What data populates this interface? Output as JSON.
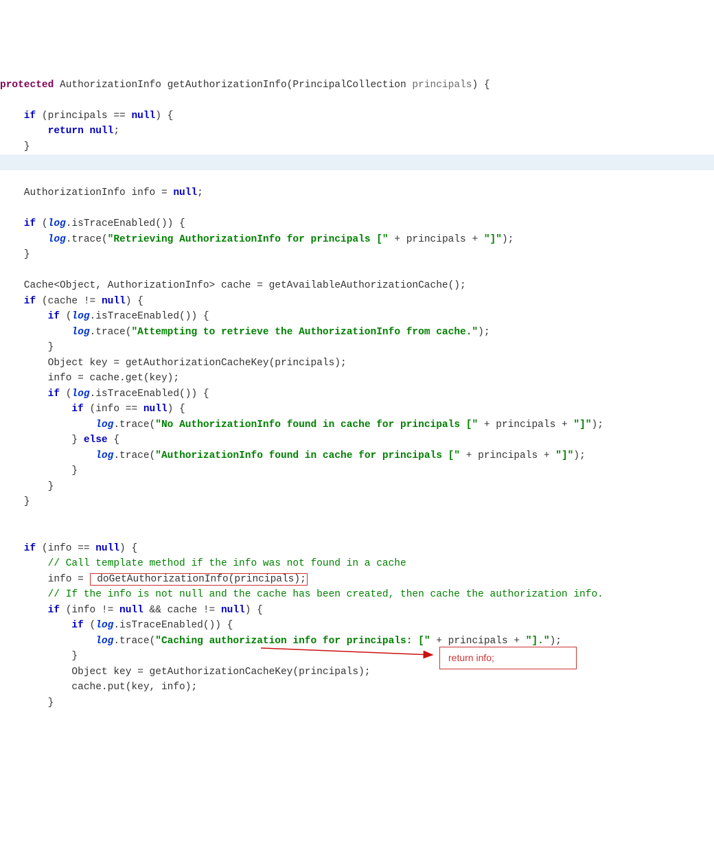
{
  "code": {
    "l00": "protected",
    "l00b": " AuthorizationInfo getAuthorizationInfo(PrincipalCollection ",
    "l00c": "principals",
    "l00d": ") {",
    "l01a": "    if",
    "l01b": " (principals == ",
    "l01c": "null",
    "l01d": ") {",
    "l02a": "        return null",
    "l02b": ";",
    "l03": "    }",
    "l04a": "    AuthorizationInfo info = ",
    "l04b": "null",
    "l04c": ";",
    "l05a": "    if",
    "l05b": " (",
    "l05c": "log",
    "l05d": ".isTraceEnabled()) {",
    "l06a": "        ",
    "l06b": "log",
    "l06c": ".trace(",
    "l06d": "\"Retrieving AuthorizationInfo for principals [\"",
    "l06e": " + principals + ",
    "l06f": "\"]\"",
    "l06g": ");",
    "l07": "    }",
    "l08": "    Cache<Object, AuthorizationInfo> cache = getAvailableAuthorizationCache();",
    "l09a": "    if",
    "l09b": " (cache != ",
    "l09c": "null",
    "l09d": ") {",
    "l10a": "        if",
    "l10b": " (",
    "l10c": "log",
    "l10d": ".isTraceEnabled()) {",
    "l11a": "            ",
    "l11b": "log",
    "l11c": ".trace(",
    "l11d": "\"Attempting to retrieve the AuthorizationInfo from cache.\"",
    "l11e": ");",
    "l12": "        }",
    "l13": "        Object key = getAuthorizationCacheKey(principals);",
    "l14": "        info = cache.get(key);",
    "l15a": "        if",
    "l15b": " (",
    "l15c": "log",
    "l15d": ".isTraceEnabled()) {",
    "l16a": "            if",
    "l16b": " (info == ",
    "l16c": "null",
    "l16d": ") {",
    "l17a": "                ",
    "l17b": "log",
    "l17c": ".trace(",
    "l17d": "\"No AuthorizationInfo found in cache for principals [\"",
    "l17e": " + principals + ",
    "l17f": "\"]\"",
    "l17g": ");",
    "l18a": "            } ",
    "l18b": "else",
    "l18c": " {",
    "l19a": "                ",
    "l19b": "log",
    "l19c": ".trace(",
    "l19d": "\"AuthorizationInfo found in cache for principals [\"",
    "l19e": " + principals + ",
    "l19f": "\"]\"",
    "l19g": ");",
    "l20": "            }",
    "l21": "        }",
    "l22": "    }",
    "l23a": "    if",
    "l23b": " (info == ",
    "l23c": "null",
    "l23d": ") {",
    "l24": "        // Call template method if the info was not found in a cache",
    "l25a": "        info = ",
    "l25b": " doGetAuthorizationInfo(principals);",
    "l26": "        // If the info is not null and the cache has been created, then cache the authorization info.",
    "l27a": "        if",
    "l27b": " (info != ",
    "l27c": "null",
    "l27d": " && cache != ",
    "l27e": "null",
    "l27f": ") {",
    "l28a": "            if",
    "l28b": " (",
    "l28c": "log",
    "l28d": ".isTraceEnabled()) {",
    "l29a": "                ",
    "l29b": "log",
    "l29c": ".trace(",
    "l29d": "\"Caching authorization info for principals: [\"",
    "l29e": " + principals + ",
    "l29f": "\"].\"",
    "l29g": ");",
    "l30": "            }",
    "l31": "            Object key = getAuthorizationCacheKey(principals);",
    "l32": "            cache.put(key, info);",
    "l33": "        }"
  },
  "annotation": {
    "return_info": "return info;"
  }
}
